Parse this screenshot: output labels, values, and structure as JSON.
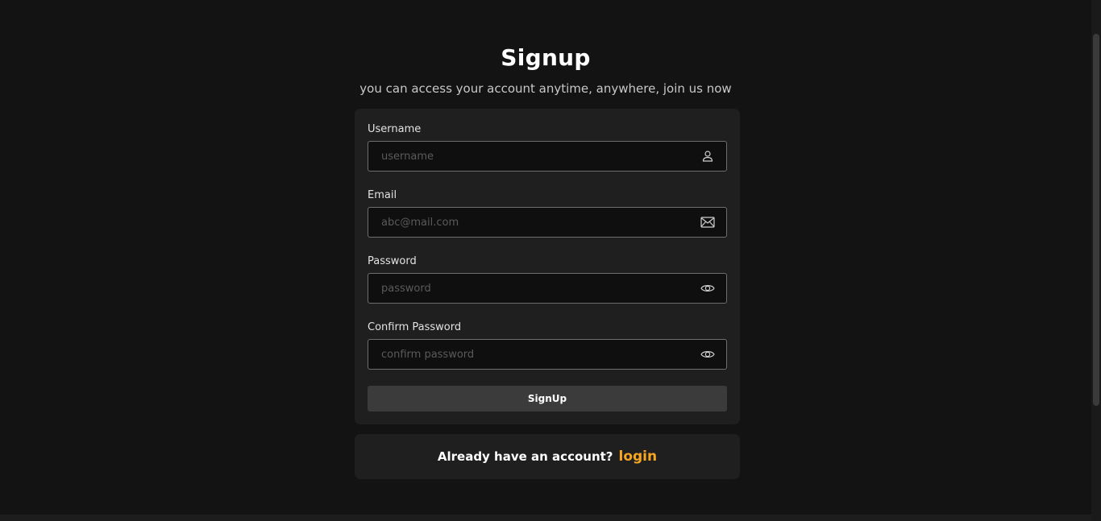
{
  "header": {
    "title": "Signup",
    "subtitle": "you can access your account anytime, anywhere, join us now"
  },
  "form": {
    "username": {
      "label": "Username",
      "placeholder": "username",
      "icon": "user-icon"
    },
    "email": {
      "label": "Email",
      "placeholder": "abc@mail.com",
      "icon": "mail-icon"
    },
    "password": {
      "label": "Password",
      "placeholder": "password",
      "icon": "eye-icon"
    },
    "confirm_password": {
      "label": "Confirm Password",
      "placeholder": "confirm password",
      "icon": "eye-icon"
    },
    "submit_label": "SignUp"
  },
  "login_prompt": {
    "text": "Already have an account?",
    "link_label": "login"
  },
  "colors": {
    "background": "#131313",
    "card": "#1f1f1f",
    "accent": "#f5a623",
    "button": "#3b3b3b"
  }
}
